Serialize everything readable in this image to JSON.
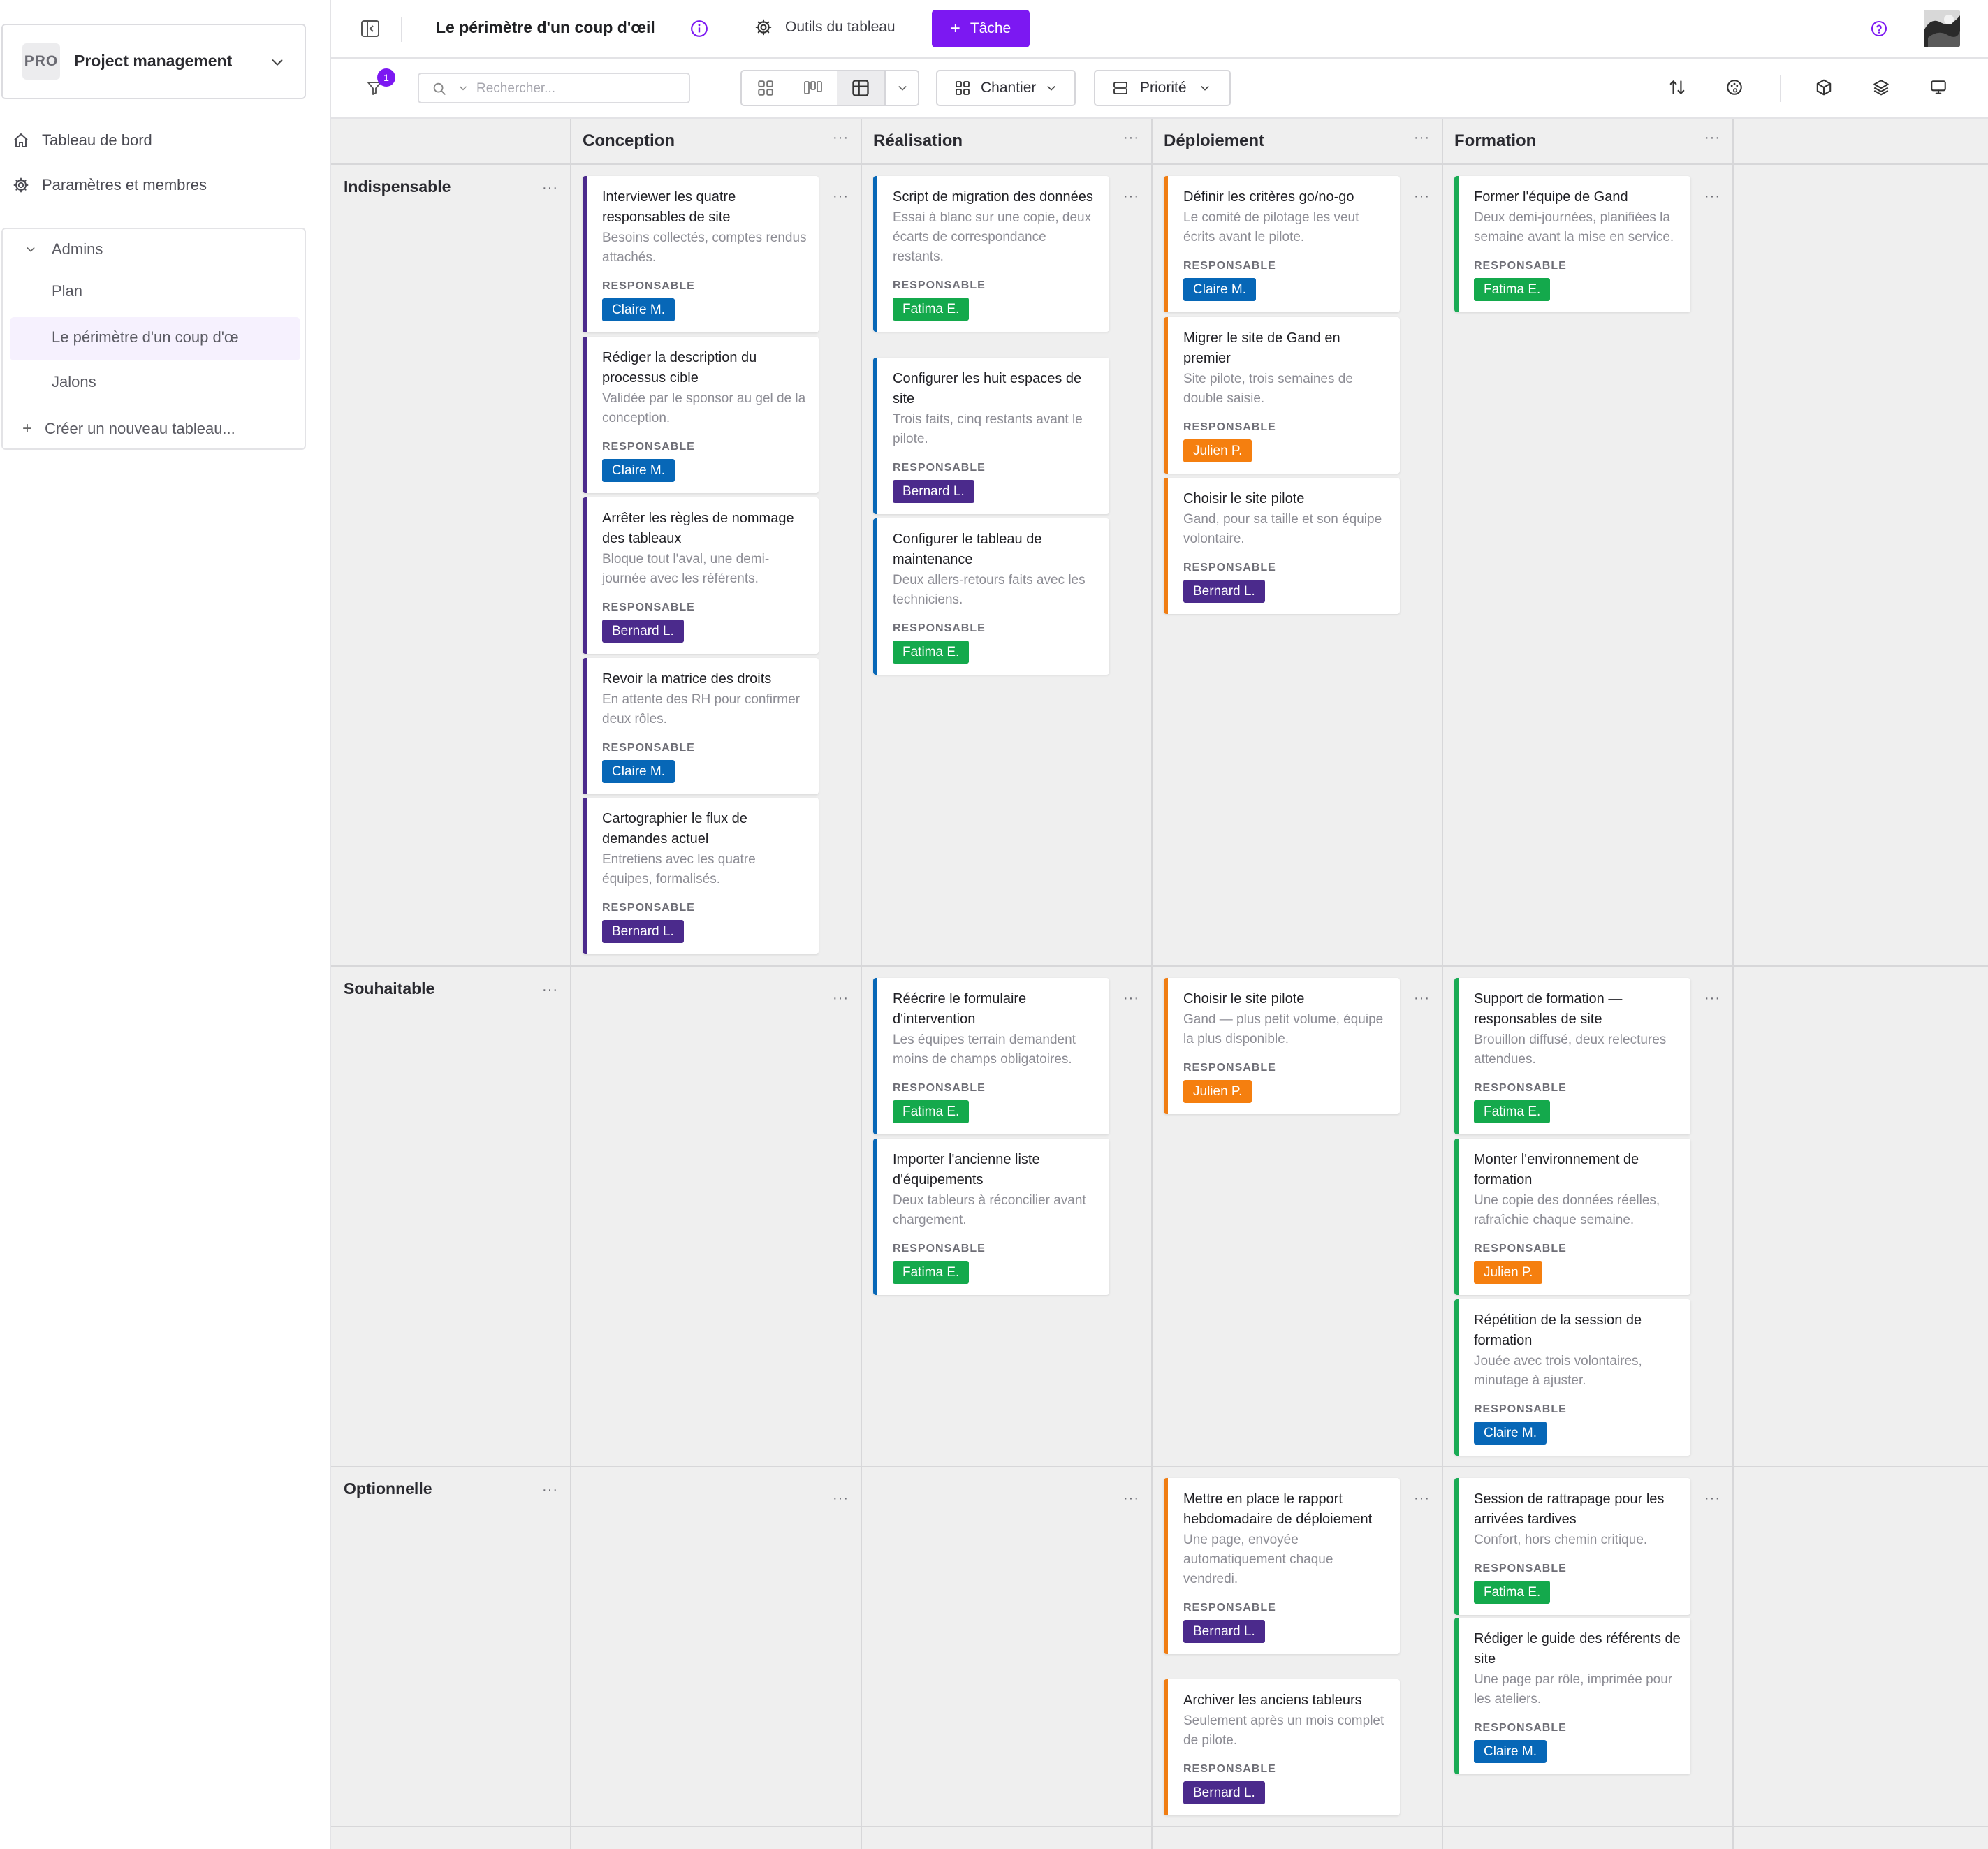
{
  "colors": {
    "accent": "#7c18f2",
    "conception": "#4b2a8c",
    "realisation": "#0767b7",
    "deploiement": "#f07d12",
    "formation": "#1aab55",
    "assignees": {
      "Claire M.": "#0767b7",
      "Bernard L.": "#4b2a8c",
      "Fatima E.": "#14a94c",
      "Julien P.": "#f57f0f"
    }
  },
  "sidebar": {
    "project_badge": "PRO",
    "project_name": "Project management",
    "nav": [
      {
        "label": "Tableau de bord",
        "icon": "home-icon"
      },
      {
        "label": "Paramètres et membres",
        "icon": "gear-icon"
      }
    ],
    "group_label": "Admins",
    "boards": [
      "Plan",
      "Le périmètre d'un coup d'œ",
      "Jalons"
    ],
    "create_label": "Créer un nouveau tableau..."
  },
  "topbar": {
    "title": "Le périmètre d'un coup d'œil",
    "tools_label": "Outils du tableau",
    "task_label": "Tâche"
  },
  "toolbar": {
    "filter_count": "1",
    "search_placeholder": "Rechercher...",
    "group_by_label": "Chantier",
    "row_by_label": "Priorité"
  },
  "board": {
    "resp_label": "RESPONSABLE",
    "columns": [
      "Conception",
      "Réalisation",
      "Déploiement",
      "Formation"
    ],
    "rows": [
      "Indispensable",
      "Souhaitable",
      "Optionnelle"
    ],
    "cards": [
      {
        "title": "Interviewer les quatre responsables de site",
        "desc": "Besoins collectés, comptes rendus attachés.",
        "assignee": "Claire M."
      },
      {
        "title": "Rédiger la description du processus cible",
        "desc": "Validée par le sponsor au gel de la conception.",
        "assignee": "Claire M."
      },
      {
        "title": "Arrêter les règles de nommage des tableaux",
        "desc": "Bloque tout l'aval, une demi-journée avec les référents.",
        "assignee": "Bernard L."
      },
      {
        "title": "Revoir la matrice des droits",
        "desc": "En attente des RH pour confirmer deux rôles.",
        "assignee": "Claire M."
      },
      {
        "title": "Cartographier le flux de demandes actuel",
        "desc": "Entretiens avec les quatre équipes, formalisés.",
        "assignee": "Bernard L."
      },
      {
        "title": "Script de migration des données",
        "desc": "Essai à blanc sur une copie, deux écarts de correspondance restants.",
        "assignee": "Fatima E."
      },
      {
        "title": "Configurer les huit espaces de site",
        "desc": "Trois faits, cinq restants avant le pilote.",
        "assignee": "Bernard L."
      },
      {
        "title": "Configurer le tableau de maintenance",
        "desc": "Deux allers-retours faits avec les techniciens.",
        "assignee": "Fatima E."
      },
      {
        "title": "Définir les critères go/no-go",
        "desc": "Le comité de pilotage les veut écrits avant le pilote.",
        "assignee": "Claire M."
      },
      {
        "title": "Migrer le site de Gand en premier",
        "desc": "Site pilote, trois semaines de double saisie.",
        "assignee": "Julien P."
      },
      {
        "title": "Choisir le site pilote",
        "desc": "Gand, pour sa taille et son équipe volontaire.",
        "assignee": "Bernard L."
      },
      {
        "title": "Former l'équipe de Gand",
        "desc": "Deux demi-journées, planifiées la semaine avant la mise en service.",
        "assignee": "Fatima E."
      },
      {
        "title": "Réécrire le formulaire d'intervention",
        "desc": "Les équipes terrain demandent moins de champs obligatoires.",
        "assignee": "Fatima E."
      },
      {
        "title": "Importer l'ancienne liste d'équipements",
        "desc": "Deux tableurs à réconcilier avant chargement.",
        "assignee": "Fatima E."
      },
      {
        "title": "Choisir le site pilote",
        "desc": "Gand — plus petit volume, équipe la plus disponible.",
        "assignee": "Julien P."
      },
      {
        "title": "Support de formation — responsables de site",
        "desc": "Brouillon diffusé, deux relectures attendues.",
        "assignee": "Fatima E."
      },
      {
        "title": "Monter l'environnement de formation",
        "desc": "Une copie des données réelles, rafraîchie chaque semaine.",
        "assignee": "Julien P."
      },
      {
        "title": "Répétition de la session de formation",
        "desc": "Jouée avec trois volontaires, minutage à ajuster.",
        "assignee": "Claire M."
      },
      {
        "title": "Mettre en place le rapport hebdomadaire de déploiement",
        "desc": "Une page, envoyée automatiquement chaque vendredi.",
        "assignee": "Bernard L."
      },
      {
        "title": "Archiver les anciens tableurs",
        "desc": "Seulement après un mois complet de pilote.",
        "assignee": "Bernard L."
      },
      {
        "title": "Session de rattrapage pour les arrivées tardives",
        "desc": "Confort, hors chemin critique.",
        "assignee": "Fatima E."
      },
      {
        "title": "Rédiger le guide des référents de site",
        "desc": "Une page par rôle, imprimée pour les ateliers.",
        "assignee": "Claire M."
      }
    ]
  }
}
